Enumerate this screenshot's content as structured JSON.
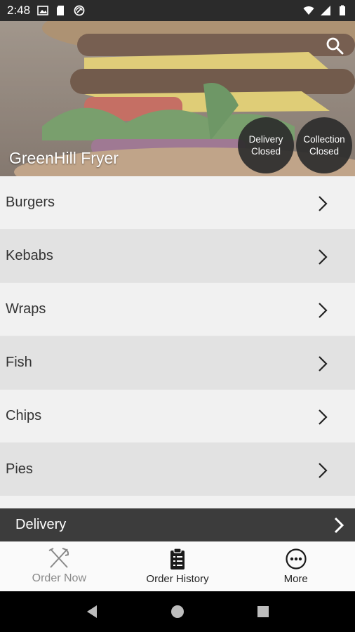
{
  "status_bar": {
    "time": "2:48"
  },
  "hero": {
    "title": "GreenHill Fryer",
    "delivery_pill": {
      "line1": "Delivery",
      "line2": "Closed"
    },
    "collection_pill": {
      "line1": "Collection",
      "line2": "Closed"
    }
  },
  "categories": [
    {
      "label": "Burgers"
    },
    {
      "label": "Kebabs"
    },
    {
      "label": "Wraps"
    },
    {
      "label": "Fish"
    },
    {
      "label": "Chips"
    },
    {
      "label": "Pies"
    }
  ],
  "delivery_bar": {
    "label": "Delivery"
  },
  "bottom_nav": {
    "items": [
      {
        "label": "Order Now",
        "icon": "cutlery-icon",
        "state": "disabled"
      },
      {
        "label": "Order History",
        "icon": "clipboard-icon",
        "state": "enabled"
      },
      {
        "label": "More",
        "icon": "more-icon",
        "state": "enabled"
      }
    ]
  },
  "colors": {
    "status_bar": "#2b2b2b",
    "row_light": "#f1f1f1",
    "row_dark": "#e2e2e2",
    "delivery_bar": "#3c3c3c",
    "pill": "#2d2d2d"
  }
}
